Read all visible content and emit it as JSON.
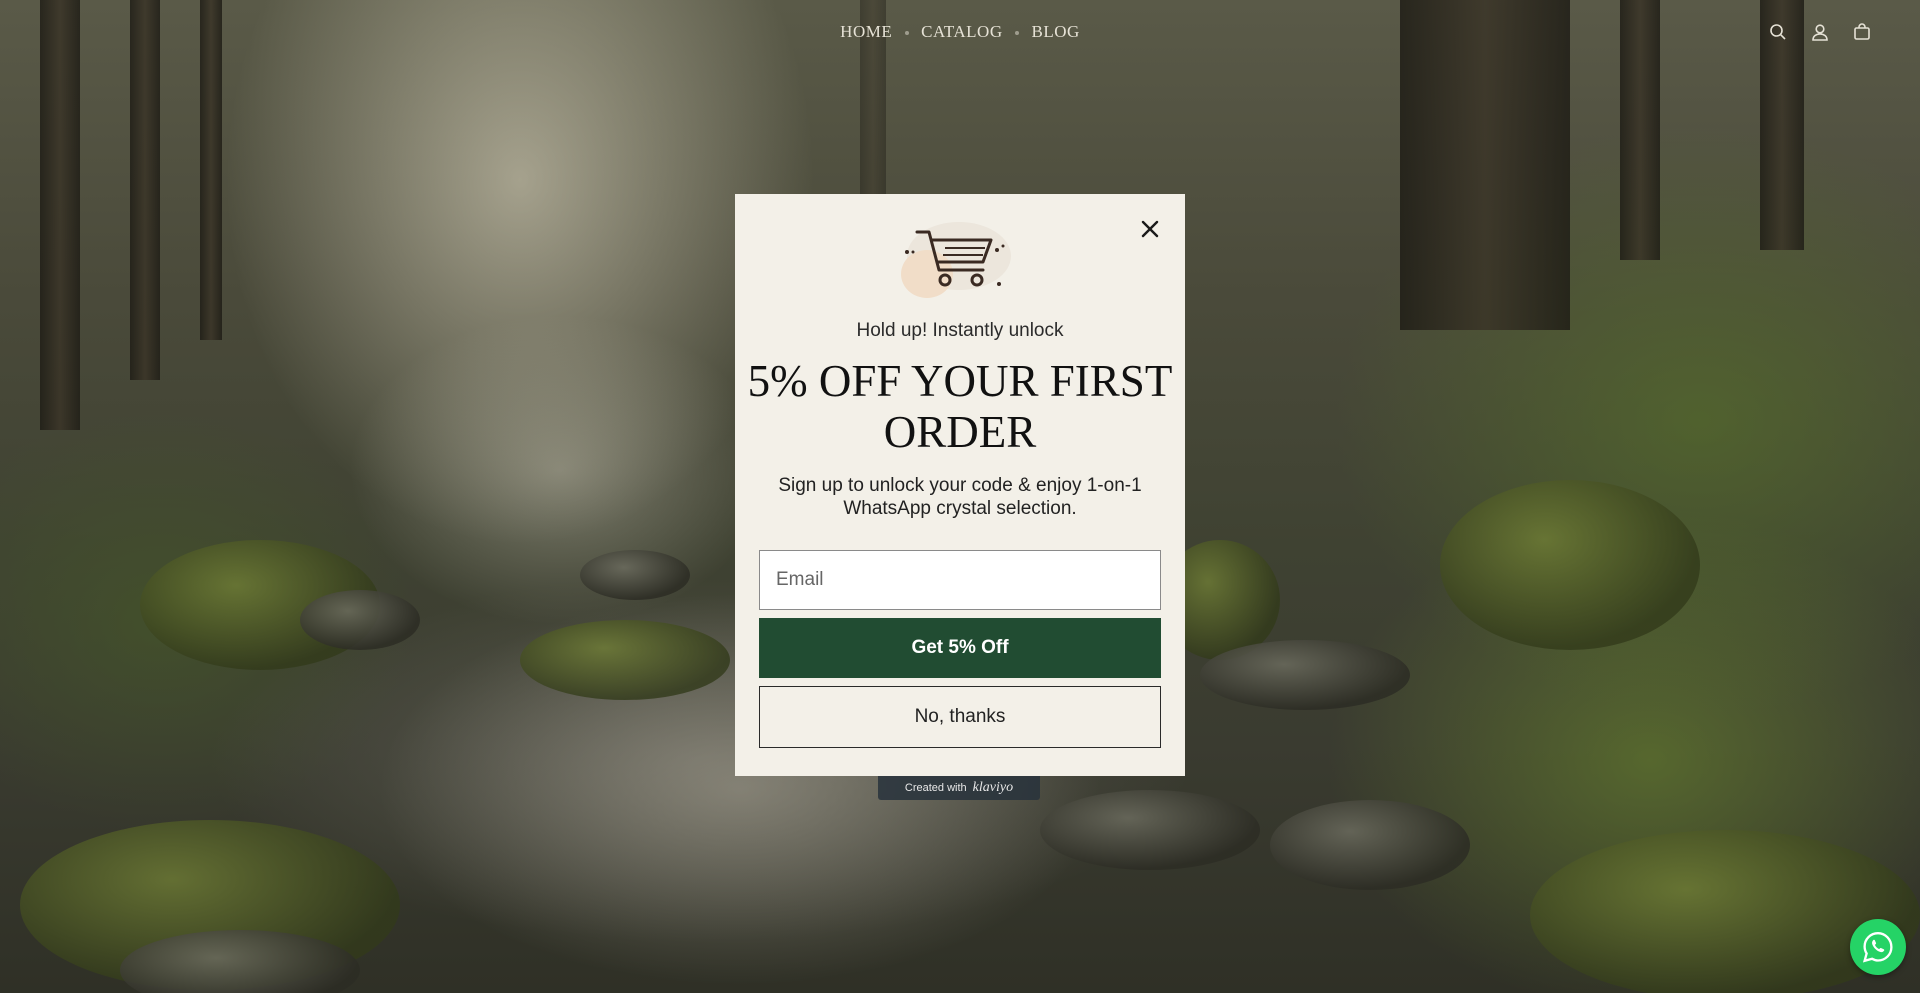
{
  "nav": {
    "items": [
      "HOME",
      "CATALOG",
      "BLOG"
    ]
  },
  "header_icons": [
    "search-icon",
    "account-icon",
    "cart-bag-icon"
  ],
  "popup": {
    "pre_heading": "Hold up! Instantly unlock",
    "headline": "5% OFF YOUR FIRST ORDER",
    "subtext": "Sign up to unlock your code & enjoy 1-on-1 WhatsApp crystal selection.",
    "email_placeholder": "Email",
    "email_value": "",
    "cta_label": "Get 5% Off",
    "decline_label": "No, thanks",
    "accent_color": "#214c32"
  },
  "badge": {
    "prefix": "Created with",
    "brand": "klaviyo"
  },
  "floating": {
    "whatsapp_icon": "whatsapp-icon",
    "whatsapp_color": "#25d366"
  }
}
